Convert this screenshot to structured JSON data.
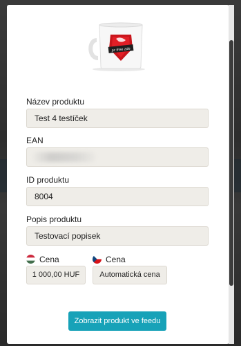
{
  "product": {
    "image_label": "product-mug",
    "mug_text": "pr free zde"
  },
  "fields": {
    "name": {
      "label": "Název produktu",
      "value": "Test 4 testíček"
    },
    "ean": {
      "label": "EAN",
      "value": ""
    },
    "id": {
      "label": "ID produktu",
      "value": "8004"
    },
    "description": {
      "label": "Popis produktu",
      "value": "Testovací popisek"
    }
  },
  "prices": {
    "hu": {
      "label": "Cena",
      "value": "1 000,00 HUF",
      "flag": "hungary-flag-icon"
    },
    "cz": {
      "label": "Cena",
      "value": "Automatická cena",
      "flag": "czech-flag-icon"
    }
  },
  "actions": {
    "show_in_feed": "Zobrazit produkt ve feedu"
  },
  "colors": {
    "accent": "#17a2b8",
    "input_bg": "#efede8"
  }
}
